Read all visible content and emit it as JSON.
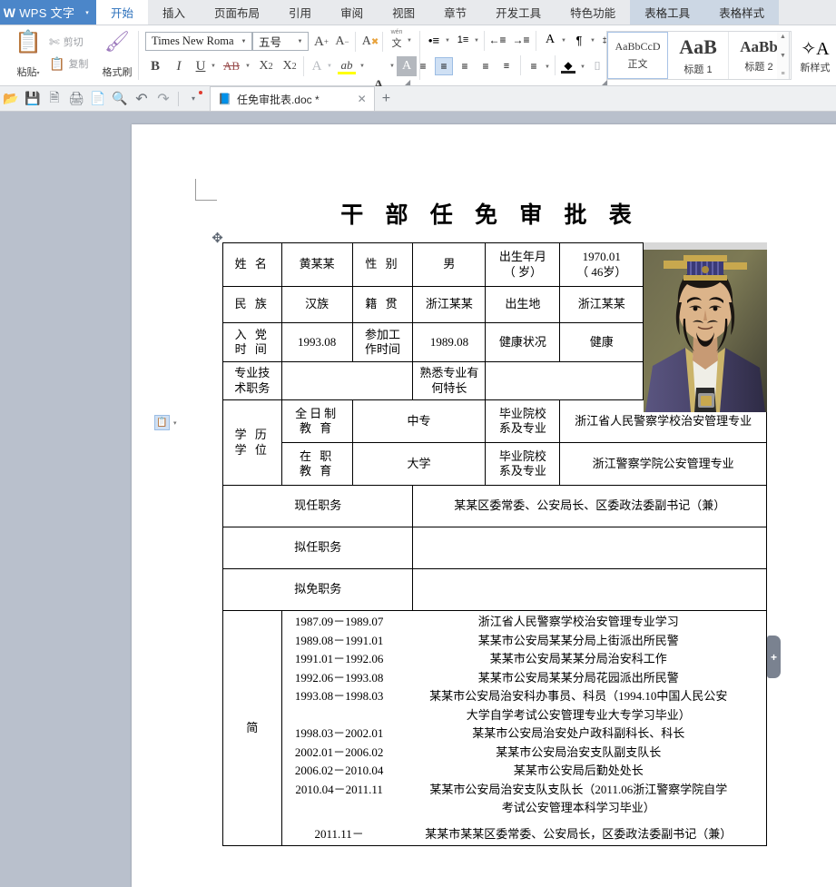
{
  "app": {
    "name": "WPS 文字",
    "logo_mark": "W",
    "dropdown_icon": "▾"
  },
  "ribbon_tabs": [
    {
      "label": "开始",
      "state": "active"
    },
    {
      "label": "插入",
      "state": "normal"
    },
    {
      "label": "页面布局",
      "state": "normal"
    },
    {
      "label": "引用",
      "state": "normal"
    },
    {
      "label": "审阅",
      "state": "normal"
    },
    {
      "label": "视图",
      "state": "normal"
    },
    {
      "label": "章节",
      "state": "normal"
    },
    {
      "label": "开发工具",
      "state": "normal"
    },
    {
      "label": "特色功能",
      "state": "normal"
    },
    {
      "label": "表格工具",
      "state": "context"
    },
    {
      "label": "表格样式",
      "state": "context"
    }
  ],
  "clipboard": {
    "paste_label": "粘贴",
    "paste_caret": "▾",
    "cut_label": "剪切",
    "copy_label": "复制",
    "format_painter_label": "格式刷"
  },
  "font": {
    "family_value": "Times New Roma",
    "size_value": "五号",
    "grow_label": "A",
    "shrink_label": "A",
    "clear_format_label": "A",
    "pinyin_label": "文",
    "bold": "B",
    "italic": "I",
    "underline": "U",
    "strikethrough": "AB",
    "superscript": "X",
    "subscript": "X",
    "char_border_label": "A",
    "highlight_label": "ab",
    "font_color_label": "A",
    "char_shading_label": "A",
    "highlight_color": "#ffff00",
    "font_color": "#1f4fa8"
  },
  "paragraph": {
    "bullet_list": "•≡",
    "number_list": "1≡",
    "decrease_indent": "←≡",
    "increase_indent": "→≡",
    "pinyin_guide": "A",
    "show_marks": "¶",
    "borders": "⌗",
    "align_left": "≡",
    "align_center": "≡",
    "align_right": "≡",
    "align_justify": "≡",
    "distribute": "≡",
    "line_spacing": "≡",
    "shading": "◆",
    "table_borders": "⌷",
    "active_alignment": "align_center"
  },
  "styles": {
    "items": [
      {
        "preview": "AaBbCcD",
        "name": "正文",
        "kind": "body"
      },
      {
        "preview": "AaB",
        "name": "标题 1",
        "kind": "h1"
      },
      {
        "preview": "AaBb",
        "name": "标题 2",
        "kind": "h2"
      }
    ],
    "new_style_label": "新样式",
    "new_style_icon": "A",
    "scroll_up": "▲",
    "scroll_down": "▼",
    "scroll_more": "≡"
  },
  "quickbar": {
    "buttons": [
      {
        "name": "open",
        "glyph": "📂"
      },
      {
        "name": "save",
        "glyph": "💾"
      },
      {
        "name": "export-pdf",
        "glyph": "🗎"
      },
      {
        "name": "print",
        "glyph": "🖨"
      },
      {
        "name": "print-preview",
        "glyph": "📄"
      },
      {
        "name": "find",
        "glyph": "🔍"
      },
      {
        "name": "undo",
        "glyph": "↶"
      },
      {
        "name": "redo",
        "glyph": "↷"
      },
      {
        "name": "customize",
        "glyph": "▾"
      }
    ],
    "document_tab": {
      "icon": "📘",
      "title": "任免审批表.doc *",
      "close": "✕"
    },
    "new_tab": "+"
  },
  "document": {
    "title": "干 部 任 免 审 批 表",
    "plus_widget": "+",
    "smart_tag_icon": "📋",
    "smart_tag_caret": "▾",
    "move_handle_icon": "✥",
    "table": {
      "row1": {
        "name_label": "姓  名",
        "name_value": "黄某某",
        "gender_label": "性  别",
        "gender_value": "男",
        "birth_label": "出生年月（    岁）",
        "birth_label_l1": "出生年月",
        "birth_label_l2": "（    岁）",
        "birth_value_l1": "1970.01",
        "birth_value_l2": "（ 46岁）"
      },
      "row2": {
        "ethnic_label": "民  族",
        "ethnic_value": "汉族",
        "native_label": "籍  贯",
        "native_value": "浙江某某",
        "birthplace_label": "出生地",
        "birthplace_value": "浙江某某"
      },
      "row3": {
        "party_label_l1": "入  党",
        "party_label_l2": "时  间",
        "party_value": "1993.08",
        "work_label_l1": "参加工",
        "work_label_l2": "作时间",
        "work_value": "1989.08",
        "health_label": "健康状况",
        "health_value": "健康"
      },
      "row4": {
        "tech_label_l1": "专业技",
        "tech_label_l2": "术职务",
        "tech_value": "",
        "specialty_label_l1": "熟悉专业有",
        "specialty_label_l2": "何特长",
        "specialty_value": ""
      },
      "edu": {
        "label_l1": "学  历",
        "label_l2": "学  位",
        "fulltime_l1": "全日制",
        "fulltime_l2": "教   育",
        "fulltime_value": "中专",
        "school_label_l1": "毕业院校",
        "school_label_l2": "系及专业",
        "fulltime_school": "浙江省人民警察学校治安管理专业",
        "inservice_l1": "在   职",
        "inservice_l2": "教   育",
        "inservice_value": "大学",
        "inservice_school": "浙江警察学院公安管理专业"
      },
      "positions": [
        {
          "label": "现任职务",
          "value": "某某区委常委、公安局长、区委政法委副书记（兼）"
        },
        {
          "label": "拟任职务",
          "value": ""
        },
        {
          "label": "拟免职务",
          "value": ""
        }
      ],
      "resume": {
        "label": "简",
        "entries": [
          {
            "date": "1987.09－1989.07",
            "text": "浙江省人民警察学校治安管理专业学习",
            "cont": ""
          },
          {
            "date": "1989.08－1991.01",
            "text": "某某市公安局某某分局上街派出所民警",
            "cont": ""
          },
          {
            "date": "1991.01－1992.06",
            "text": "某某市公安局某某分局治安科工作",
            "cont": ""
          },
          {
            "date": "1992.06－1993.08",
            "text": "某某市公安局某某分局花园派出所民警",
            "cont": ""
          },
          {
            "date": "1993.08－1998.03",
            "text": "某某市公安局治安科办事员、科员（1994.10中国人民公安",
            "cont": "大学自学考试公安管理专业大专学习毕业）"
          },
          {
            "date": "1998.03－2002.01",
            "text": "某某市公安局治安处户政科副科长、科长",
            "cont": ""
          },
          {
            "date": "2002.01－2006.02",
            "text": "某某市公安局治安支队副支队长",
            "cont": ""
          },
          {
            "date": "2006.02－2010.04",
            "text": "某某市公安局后勤处处长",
            "cont": ""
          },
          {
            "date": "2010.04－2011.11",
            "text": "某某市公安局治安支队支队长（2011.06浙江警察学院自学",
            "cont": "考试公安管理本科学习毕业）"
          },
          {
            "date": "2011.11－",
            "text": "某某市某某区委常委、公安局长，区委政法委副书记（兼）",
            "cont": ""
          }
        ]
      }
    }
  }
}
